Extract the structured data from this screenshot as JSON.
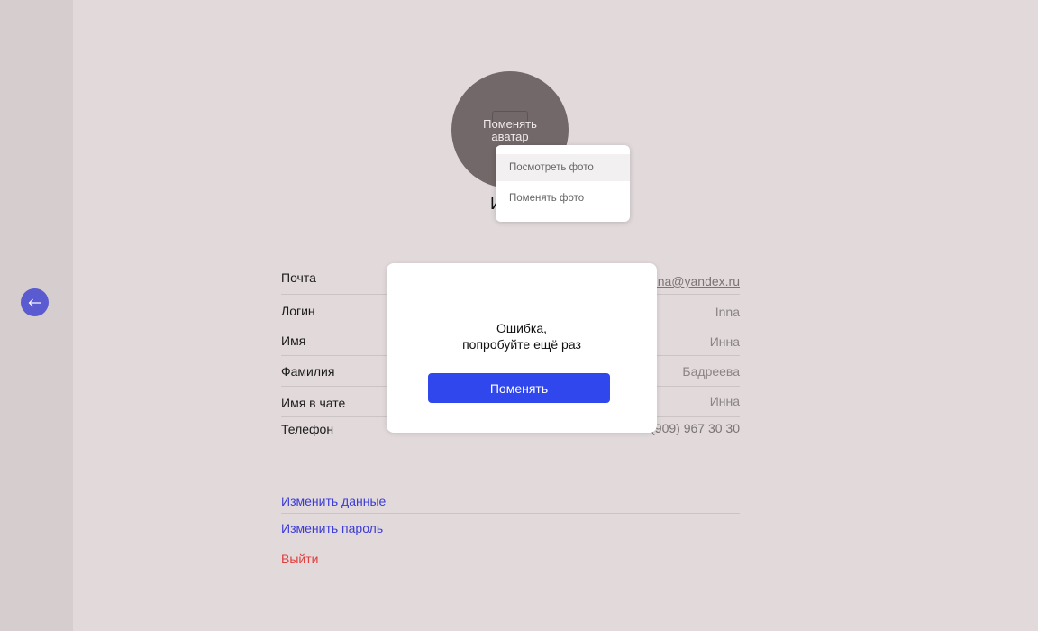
{
  "sidebar": {
    "back_icon": "arrow-left-icon"
  },
  "avatar": {
    "overlay_line1": "Поменять",
    "overlay_line2": "аватар",
    "menu": [
      {
        "label": "Посмотреть фото"
      },
      {
        "label": "Поменять фото"
      }
    ]
  },
  "profile": {
    "display_name_visible": "И"
  },
  "fields": [
    {
      "label": "Почта",
      "value": "inna@yandex.ru"
    },
    {
      "label": "Логин",
      "value": "Inna"
    },
    {
      "label": "Имя",
      "value": "Инна"
    },
    {
      "label": "Фамилия",
      "value": "Бадреева"
    },
    {
      "label": "Имя в чате",
      "value": "Инна"
    },
    {
      "label": "Телефон",
      "value": "+7 (909) 967 30 30"
    }
  ],
  "actions": {
    "edit_data": "Изменить данные",
    "change_password": "Изменить пароль",
    "logout": "Выйти"
  },
  "modal": {
    "message_line1": "Ошибка,",
    "message_line2": "попробуйте ещё раз",
    "button_label": "Поменять"
  },
  "colors": {
    "background": "#e1d9da",
    "sidebar": "#d6cdce",
    "accent_blue": "#3147ee",
    "link_blue": "#3b3bd6",
    "logout_red": "#e03d3d",
    "back_button": "#5a5ad1"
  }
}
